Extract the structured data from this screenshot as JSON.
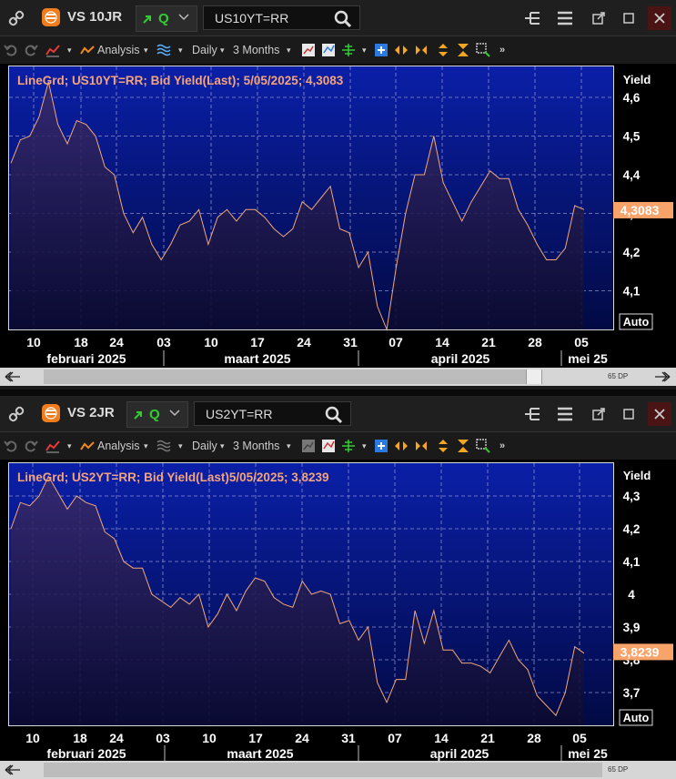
{
  "panels": [
    {
      "title": "VS 10JR",
      "quote_label": "Q",
      "ric": "US10YT=RR",
      "toolbar": {
        "analysis": "Analysis",
        "interval": "Daily",
        "range": "3 Months"
      },
      "chart_data": {
        "type": "line",
        "title": "LineGrd; US10YT=RR; Bid Yield(Last); 5/05/2025; 4,3083",
        "ylabel": "Yield",
        "ylim": [
          4.0,
          4.68
        ],
        "yticks": [
          "4,6",
          "4,5",
          "4,4",
          "4,3",
          "4,2",
          "4,1"
        ],
        "ytick_values": [
          4.6,
          4.5,
          4.4,
          4.3,
          4.2,
          4.1
        ],
        "xticks": [
          "10",
          "18",
          "24",
          "03",
          "10",
          "17",
          "24",
          "31",
          "07",
          "14",
          "21",
          "28",
          "05"
        ],
        "months": [
          "februari 2025",
          "maart 2025",
          "april 2025",
          "mei 25"
        ],
        "last_value_label": "4,3083",
        "last_value": 4.3083,
        "auto_label": "Auto",
        "series": [
          {
            "values": [
              4.43,
              4.49,
              4.5,
              4.55,
              4.64,
              4.53,
              4.48,
              4.54,
              4.53,
              4.5,
              4.42,
              4.4,
              4.3,
              4.25,
              4.29,
              4.22,
              4.18,
              4.22,
              4.27,
              4.28,
              4.31,
              4.22,
              4.29,
              4.31,
              4.28,
              4.31,
              4.31,
              4.29,
              4.26,
              4.24,
              4.26,
              4.33,
              4.31,
              4.34,
              4.37,
              4.26,
              4.25,
              4.16,
              4.2,
              4.06,
              4.0,
              4.16,
              4.3,
              4.4,
              4.4,
              4.5,
              4.38,
              4.33,
              4.28,
              4.33,
              4.37,
              4.41,
              4.39,
              4.39,
              4.31,
              4.27,
              4.22,
              4.18,
              4.18,
              4.21,
              4.32,
              4.31
            ]
          }
        ]
      },
      "navbar": {
        "dp": "65 DP"
      }
    },
    {
      "title": "VS 2JR",
      "quote_label": "Q",
      "ric": "US2YT=RR",
      "toolbar": {
        "analysis": "Analysis",
        "interval": "Daily",
        "range": "3 Months"
      },
      "chart_data": {
        "type": "line",
        "title": "LineGrd; US2YT=RR; Bid Yield(Last)5/05/2025; 3,8239",
        "ylabel": "Yield",
        "ylim": [
          3.6,
          4.4
        ],
        "yticks": [
          "4,3",
          "4,2",
          "4,1",
          "4",
          "3,9",
          "3,8",
          "3,7"
        ],
        "ytick_values": [
          4.3,
          4.2,
          4.1,
          4.0,
          3.9,
          3.8,
          3.7
        ],
        "xticks": [
          "10",
          "18",
          "24",
          "03",
          "10",
          "17",
          "24",
          "31",
          "07",
          "14",
          "21",
          "28",
          "05"
        ],
        "months": [
          "februari 2025",
          "maart 2025",
          "april 2025",
          "mei 25"
        ],
        "last_value_label": "3,8239",
        "last_value": 3.8239,
        "auto_label": "Auto",
        "series": [
          {
            "values": [
              4.2,
              4.28,
              4.27,
              4.3,
              4.36,
              4.31,
              4.26,
              4.3,
              4.28,
              4.27,
              4.19,
              4.17,
              4.1,
              4.08,
              4.08,
              4.0,
              3.98,
              3.96,
              3.99,
              3.97,
              4.0,
              3.9,
              3.94,
              4.0,
              3.95,
              4.01,
              4.05,
              4.04,
              3.99,
              3.97,
              3.96,
              4.04,
              4.0,
              4.01,
              4.0,
              3.91,
              3.92,
              3.86,
              3.9,
              3.73,
              3.67,
              3.74,
              3.74,
              3.95,
              3.85,
              3.95,
              3.83,
              3.83,
              3.79,
              3.79,
              3.78,
              3.76,
              3.81,
              3.86,
              3.8,
              3.77,
              3.69,
              3.66,
              3.63,
              3.7,
              3.84,
              3.82
            ]
          }
        ]
      },
      "navbar": {
        "dp": "65 DP"
      }
    }
  ]
}
